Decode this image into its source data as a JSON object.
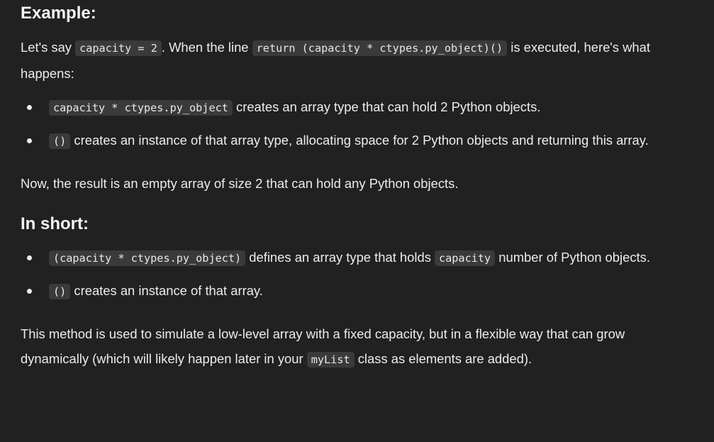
{
  "example": {
    "heading": "Example:",
    "intro": {
      "t1": "Let's say ",
      "c1": "capacity = 2",
      "t2": ". When the line ",
      "c2": "return (capacity * ctypes.py_object)()",
      "t3": " is executed, here's what happens:"
    },
    "bullets": [
      {
        "code": "capacity * ctypes.py_object",
        "text": " creates an array type that can hold 2 Python objects."
      },
      {
        "code": "()",
        "text": " creates an instance of that array type, allocating space for 2 Python objects and returning this array."
      }
    ],
    "result": "Now, the result is an empty array of size 2 that can hold any Python objects."
  },
  "short": {
    "heading": "In short:",
    "bullet1": {
      "code1": "(capacity * ctypes.py_object)",
      "t1": " defines an array type that holds ",
      "code2": "capacity",
      "t2": " number of Python objects."
    },
    "bullet2": {
      "code": "()",
      "text": " creates an instance of that array."
    }
  },
  "method": {
    "t1": "This method is used to simulate a low-level array with a fixed capacity, but in a flexible way that can grow dynamically (which will likely happen later in your ",
    "code": "myList",
    "t2": " class as elements are added)."
  }
}
